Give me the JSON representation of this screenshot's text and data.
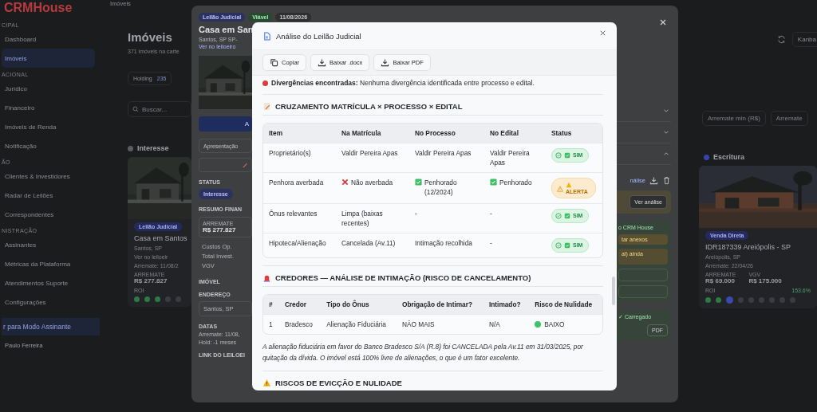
{
  "app": {
    "logo": "CRMHouse",
    "breadcrumb": "Imóveis"
  },
  "sidebar": {
    "groups": [
      {
        "label": "CIPAL",
        "items": [
          {
            "label": "Dashboard",
            "selected": false
          },
          {
            "label": "Imóveis",
            "selected": true
          }
        ]
      },
      {
        "label": "ACIONAL",
        "items": [
          {
            "label": "Jurídico",
            "selected": false
          },
          {
            "label": "Financeiro",
            "selected": false
          },
          {
            "label": "Imóveis de Renda",
            "selected": false
          },
          {
            "label": "Notificação",
            "selected": false
          }
        ]
      },
      {
        "label": "ÃO",
        "items": [
          {
            "label": "Clientes & Investidores",
            "selected": false
          },
          {
            "label": "Radar de Leilões",
            "selected": false
          },
          {
            "label": "Correspondentes",
            "selected": false
          }
        ]
      },
      {
        "label": "NISTRAÇÃO",
        "items": [
          {
            "label": "Assinantes",
            "selected": false
          },
          {
            "label": "Métricas da Plataforma",
            "selected": false
          },
          {
            "label": "Atendimentos Suporte",
            "selected": false
          },
          {
            "label": "Configurações",
            "selected": false
          }
        ]
      }
    ],
    "mode_switch": "r para Modo Assinante",
    "user": {
      "name": "Paulo Ferreira"
    }
  },
  "page": {
    "title": "Imóveis",
    "subtitle": "371 imóveis na carte",
    "tab": {
      "label": "Holding",
      "count": "235"
    },
    "search": {
      "placeholder": "Buscar..."
    },
    "view_button": "Kanba",
    "filters": [
      {
        "placeholder": "Arremate min (R$)"
      },
      {
        "placeholder": "Arremate"
      }
    ]
  },
  "columns": [
    {
      "title": "Interesse",
      "color": "#5a5c62",
      "card": {
        "badge": "Leilão Judicial",
        "title": "Casa em Santos",
        "location": "Santos, SP",
        "link": "Ver no leiloeir",
        "date_label": "Arremate:",
        "date": "11/08/2",
        "stats": [
          {
            "label": "ARREMATE",
            "value": "R$ 277.827"
          }
        ],
        "roi_label": "ROI",
        "steps": [
          {
            "done": true,
            "current": false
          },
          {
            "done": true,
            "current": false
          },
          {
            "done": true,
            "current": false
          },
          {
            "done": false,
            "current": false
          },
          {
            "done": false,
            "current": false
          }
        ]
      }
    },
    {
      "title": "Escritura",
      "color": "#3a40b0",
      "card": {
        "badge": "Venda Direta",
        "title": "IDR187339 Areiópolis - SP",
        "location": "Areiópolis, SP",
        "date_label": "Arremate:",
        "date": "22/04/26",
        "stats": [
          {
            "label": "ARREMATE",
            "value": "R$ 69.000"
          },
          {
            "label": "VGV",
            "value": "R$ 175.000"
          }
        ],
        "roi_label": "ROI",
        "roi": "153.6%",
        "steps": [
          {
            "done": true,
            "current": false
          },
          {
            "done": true,
            "current": false
          },
          {
            "done": false,
            "current": true
          },
          {
            "done": false,
            "current": false
          },
          {
            "done": false,
            "current": false
          },
          {
            "done": false,
            "current": false
          },
          {
            "done": false,
            "current": false
          },
          {
            "done": false,
            "current": false
          },
          {
            "done": false,
            "current": false
          }
        ]
      }
    }
  ],
  "drawer": {
    "badges": [
      {
        "label": "Leilão Judicial",
        "kind": "type"
      },
      {
        "label": "Viável",
        "kind": "ok"
      },
      {
        "label": "11/08/2026",
        "kind": "date"
      }
    ],
    "title": "Casa em San",
    "location": "Santos, SP",
    "code": "SP-",
    "link": "Ver no leiloeiro",
    "primary_button": "A",
    "presentation_button": "Apresentação",
    "status_label": "STATUS",
    "status": "Interesse",
    "finance_label": "RESUMO FINAN",
    "arremate_label": "ARREMATE",
    "arremate": "R$ 277.827",
    "finance_rows": [
      "Custos Op.",
      "Total Invest.",
      "VGV"
    ],
    "property_label": "IMÓVEL",
    "address_label": "ENDEREÇO",
    "address": "Santos, SP",
    "dates_label": "DATAS",
    "date_label": "Arremate:",
    "date": "11/08,",
    "hold": "Hold: -1 meses",
    "link_label": "LINK DO LEILOEI",
    "side": {
      "analysis_link": "nálise",
      "view_button": "Ver análise",
      "crm_note": "o CRM House",
      "attach_button": "tar anexos",
      "warning": "al) ainda",
      "loaded": "✓ Carregado",
      "pdf_button": "PDF"
    }
  },
  "modal": {
    "title": "Análise do Leilão Judicial",
    "actions": [
      {
        "label": "Copiar",
        "kind": "copy"
      },
      {
        "label": "Baixar .docx",
        "kind": "download"
      },
      {
        "label": "Baixar PDF",
        "kind": "download"
      }
    ],
    "divergence": {
      "color": "#e03b3b",
      "text": "**Divergências encontradas:** Nenhuma divergência identificada entre processo e edital."
    },
    "cross_title": "CRUZAMENTO MATRÍCULA × PROCESSO × EDITAL",
    "cross_table": {
      "columns": [
        "Item",
        "Na Matrícula",
        "No Processo",
        "No Edital",
        "Status"
      ],
      "rows": [
        {
          "cells": [
            {
              "text": "Proprietário(s)"
            },
            {
              "text": "Valdir Pereira Apas"
            },
            {
              "text": "Valdir Pereira Apas"
            },
            {
              "text": "Valdir Pereira Apas"
            }
          ],
          "status": {
            "kind": "ok",
            "label": "SIM"
          }
        },
        {
          "cells": [
            {
              "text": "Penhora averbada"
            },
            {
              "text": "Não averbada",
              "kind": "cross"
            },
            {
              "text": "Penhorado (12/2024)",
              "kind": "check"
            },
            {
              "text": "Penhorado",
              "kind": "check"
            }
          ],
          "status": {
            "kind": "alert",
            "label": "ALERTA"
          }
        },
        {
          "cells": [
            {
              "text": "Ônus relevantes"
            },
            {
              "text": "Limpa (baixas recentes)"
            },
            {
              "text": "-"
            },
            {
              "text": "-"
            }
          ],
          "status": {
            "kind": "ok",
            "label": "SIM"
          }
        },
        {
          "cells": [
            {
              "text": "Hipoteca/Alienação"
            },
            {
              "text": "Cancelada (Av.11)"
            },
            {
              "text": "Intimação recolhida"
            },
            {
              "text": "-"
            }
          ],
          "status": {
            "kind": "ok",
            "label": "SIM"
          }
        }
      ]
    },
    "creditors_title": "CREDORES — ANÁLISE DE INTIMAÇÃO (RISCO DE CANCELAMENTO)",
    "creditors_table": {
      "columns": [
        "#",
        "Credor",
        "Tipo do Ônus",
        "Obrigação de Intimar?",
        "Intimado?",
        "Risco de Nulidade"
      ],
      "rows": [
        {
          "number": "1",
          "creditor": "Bradesco",
          "type": "Alienação Fiduciária",
          "obligation": "NÃO MAIS",
          "notified": "N/A",
          "risk": {
            "label": "BAIXO",
            "color": "#3cc46a"
          }
        }
      ]
    },
    "note": "A alienação fiduciária em favor do Banco Bradesco S/A (R.8) foi CANCELADA pela Av.11 em 31/03/2025, por quitação da dívida. O imóvel está 100% livre de alienações, o que é um fator excelente.",
    "risks_title": "RISCOS DE EVICÇÃO E NULIDADE"
  }
}
